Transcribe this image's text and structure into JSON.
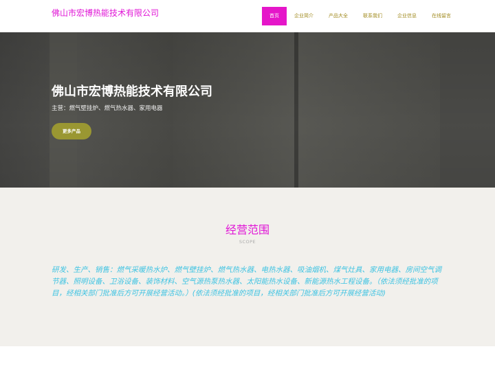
{
  "header": {
    "brand": "佛山市宏博热能技术有限公司",
    "nav": [
      "首页",
      "企业简介",
      "产品大全",
      "联系我们",
      "企业信息",
      "在线留言"
    ],
    "active_index": 0
  },
  "hero": {
    "title": "佛山市宏博热能技术有限公司",
    "subtitle": "主营：燃气壁挂炉、燃气热水器、家用电器",
    "button": "更多产品"
  },
  "scope": {
    "title": "经营范围",
    "subtitle_en": "SCOPE",
    "text": "研发、生产、销售：燃气采暖热水炉、燃气壁挂炉、燃气热水器、电热水器、吸油烟机、煤气灶具、家用电器、房间空气调节器、照明设备、卫浴设备、装饰材料、空气源热泵热水器、太阳能热水设备、新能源热水工程设备。（依法须经批准的项目，经相关部门批准后方可开展经营活动。）(依法须经批准的项目，经相关部门批准后方可开展经营活动)"
  },
  "colors": {
    "brand": "#e015d6",
    "nav_text": "#a08a1e",
    "nav_active_bg": "#e516c9",
    "button_bg": "#9a9732",
    "scope_text": "#3fc3e2",
    "scope_bg": "#f2f0ec"
  }
}
